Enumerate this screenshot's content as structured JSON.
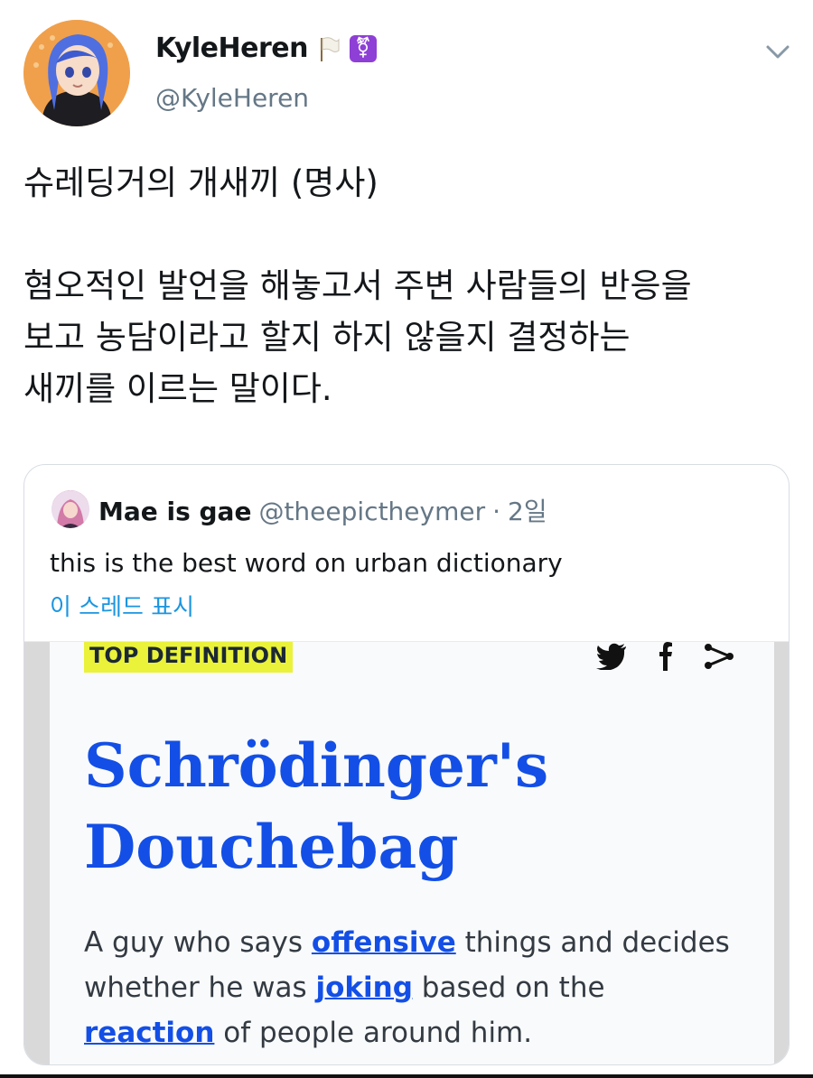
{
  "tweet": {
    "display_name": "KyleHeren",
    "name_emoji_flag": "white-flag-icon",
    "name_emoji_trans": "⚧",
    "handle": "@KyleHeren",
    "text": "슈레딩거의 개새끼 (명사)\n\n혐오적인 발언을 해놓고서 주변 사람들의 반응을\n보고 농담이라고 할지 하지 않을지 결정하는\n새끼를 이르는 말이다."
  },
  "quote": {
    "name": "Mae is gae",
    "handle": "@theepictheymer",
    "separator": "·",
    "time": "2일",
    "text": "this is the best word on urban dictionary",
    "show_thread": "이 스레드 표시"
  },
  "image": {
    "badge": "TOP DEFINITION",
    "title_line1": "Schrödinger's",
    "title_line2": "Douchebag",
    "def_1": "A guy who says ",
    "def_link1": "offensive",
    "def_2": " things and decides whether he was ",
    "def_link2": "joking",
    "def_3": " based on the ",
    "def_link3": "reaction",
    "def_4": " of people around him."
  },
  "colors": {
    "link_blue": "#134fe6",
    "badge_yellow": "#eaf23a",
    "twitter_link": "#1b95e0",
    "secondary_text": "#657786"
  }
}
